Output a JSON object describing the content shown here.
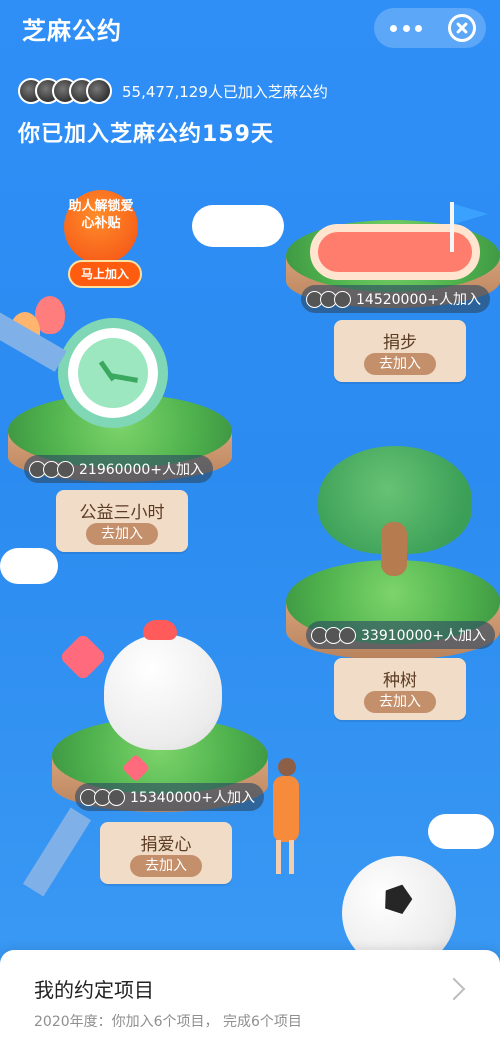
{
  "header": {
    "title": "芝麻公约"
  },
  "summary": {
    "joined_count_text": "55,477,129人已加入芝麻公约",
    "days_text": "你已加入芝麻公约159天"
  },
  "promo": {
    "text": "助人解锁爱心补贴",
    "button": "马上加入"
  },
  "projects": [
    {
      "name": "捐步",
      "count": "14520000+人加入",
      "button": "去加入"
    },
    {
      "name": "公益三小时",
      "count": "21960000+人加入",
      "button": "去加入"
    },
    {
      "name": "种树",
      "count": "33910000+人加入",
      "button": "去加入"
    },
    {
      "name": "捐爱心",
      "count": "15340000+人加入",
      "button": "去加入"
    }
  ],
  "bottom": {
    "title": "我的约定项目",
    "subtitle": "2020年度：你加入6个项目， 完成6个项目"
  }
}
